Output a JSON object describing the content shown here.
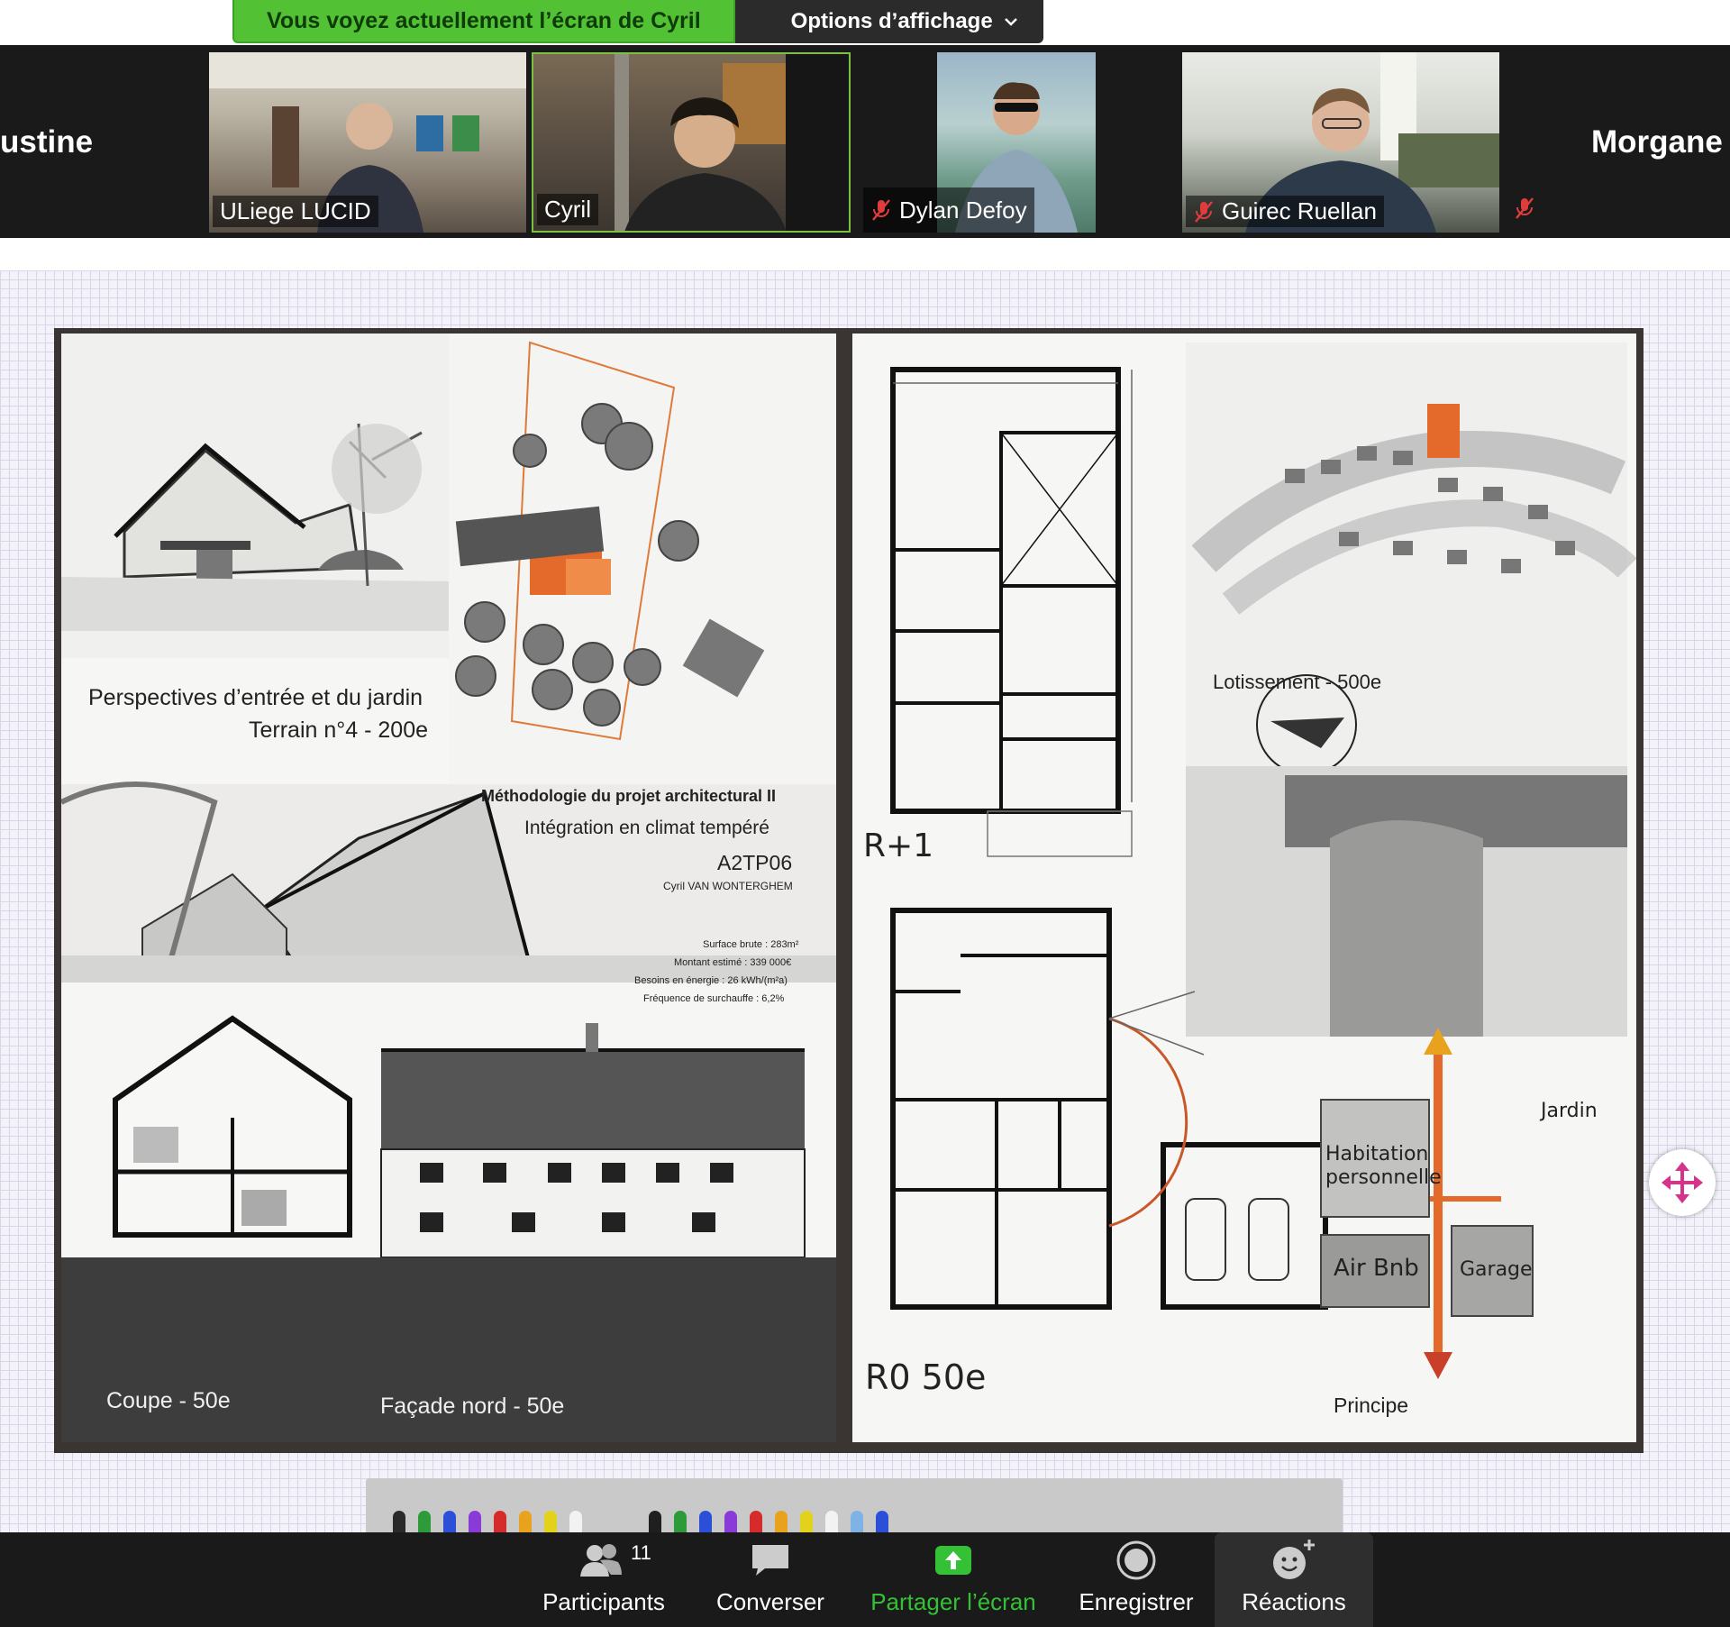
{
  "banner": {
    "sharing_text": "Vous voyez actuellement l’écran de Cyril",
    "options_label": "Options d’affichage",
    "options_icon": "chevron-down-icon"
  },
  "gallery": {
    "left_edge_name": "ustine",
    "right_edge_name": "Morgane",
    "tiles": [
      {
        "name": "ULiege LUCID",
        "muted": false
      },
      {
        "name": "Cyril",
        "muted": false,
        "active_speaker": true
      },
      {
        "name": "Dylan Defoy",
        "muted": true
      },
      {
        "name": "Guirec Ruellan",
        "muted": true
      }
    ]
  },
  "poster": {
    "left": {
      "caption_perspectives": "Perspectives d’entrée et du jardin",
      "caption_terrain": "Terrain n°4 - 200e",
      "course_title": "Méthodologie du projet architectural II",
      "course_subtitle": "Intégration en climat tempéré",
      "course_code": "A2TP06",
      "author": "Cyril VAN WONTERGHEM",
      "stats": [
        "Surface brute : 283m²",
        "Montant estimé : 339 000€",
        "Besoins en énergie : 26 kWh/(m²a)",
        "Fréquence de surchauffe : 6,2%"
      ],
      "caption_coupe": "Coupe - 50e",
      "caption_facade": "Façade nord - 50e"
    },
    "right": {
      "label_r1": "R+1",
      "label_r0": "R0 50e",
      "caption_lotissement": "Lotissement - 500e",
      "principle": {
        "jardin": "Jardin",
        "habitation": "Habitation personnelle",
        "airbnb": "Air Bnb",
        "garage": "Garage",
        "principe": "Principe"
      }
    }
  },
  "annotation": {
    "pen_colors": [
      "#2a2a2a",
      "#2e9b3a",
      "#2b4fd6",
      "#8a3ad6",
      "#d62b2b",
      "#e8a21e",
      "#e3d21c",
      "#f2f2f2",
      "#1f1f1f",
      "#2e9b3a",
      "#2b4fd6",
      "#8a3ad6",
      "#d62b2b",
      "#e8a21e",
      "#e3d21c",
      "#f2f2f2",
      "#7fb2e5",
      "#2b4fd6"
    ],
    "move_icon": "move-arrows-icon"
  },
  "controls": {
    "participants_label": "Participants",
    "participants_count": "11",
    "chat_label": "Converser",
    "share_label": "Partager l’écran",
    "record_label": "Enregistrer",
    "reactions_label": "Réactions"
  },
  "colors": {
    "share_green": "#52c234",
    "toolbar_bg": "#1a1a1a",
    "accent_orange": "#e36a2a",
    "move_magenta": "#d6338a"
  }
}
